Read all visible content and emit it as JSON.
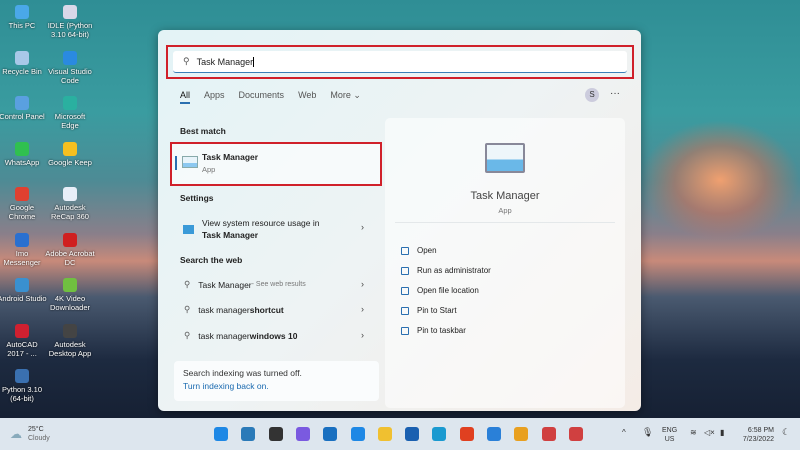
{
  "desktop_icons": [
    {
      "label": "This PC",
      "color": "#4aa8e8"
    },
    {
      "label": "IDLE (Python 3.10 64-bit)",
      "color": "#d8d8e8"
    },
    {
      "label": "Recycle Bin",
      "color": "#a8c8e8"
    },
    {
      "label": "Visual Studio Code",
      "color": "#2a8ae0"
    },
    {
      "label": "Control Panel",
      "color": "#5aa0e0"
    },
    {
      "label": "Microsoft Edge",
      "color": "#2ab0a0"
    },
    {
      "label": "WhatsApp",
      "color": "#30c050"
    },
    {
      "label": "Google Keep",
      "color": "#f5c020"
    },
    {
      "label": "Google Chrome",
      "color": "#e04030"
    },
    {
      "label": "Autodesk ReCap 360",
      "color": "#e8eef8"
    },
    {
      "label": "Imo Messenger",
      "color": "#2a70d0"
    },
    {
      "label": "Adobe Acrobat DC",
      "color": "#d02020"
    },
    {
      "label": "Android Studio",
      "color": "#3a90d0"
    },
    {
      "label": "4K Video Downloader",
      "color": "#70c040"
    },
    {
      "label": "AutoCAD 2017 - ...",
      "color": "#d02030"
    },
    {
      "label": "Autodesk Desktop App",
      "color": "#444"
    },
    {
      "label": "Python 3.10 (64-bit)",
      "color": "#3a70b0"
    }
  ],
  "search": {
    "value": "Task Manager"
  },
  "tabs": [
    "All",
    "Apps",
    "Documents",
    "Web",
    "More ⌄"
  ],
  "avatar": "S",
  "more_icon": "···",
  "best_match": {
    "heading": "Best match",
    "title": "Task Manager",
    "subtitle": "App"
  },
  "settings": {
    "heading": "Settings",
    "line1": "View system resource usage in",
    "line2": "Task Manager"
  },
  "web": {
    "heading": "Search the web",
    "items": [
      {
        "normal": "Task Manager",
        "bold": "",
        "suffix": " - See web results"
      },
      {
        "normal": "task manager ",
        "bold": "shortcut",
        "suffix": ""
      },
      {
        "normal": "task manager ",
        "bold": "windows 10",
        "suffix": ""
      }
    ]
  },
  "indexing": {
    "msg": "Search indexing was turned off.",
    "link": "Turn indexing back on."
  },
  "preview": {
    "title": "Task Manager",
    "subtitle": "App",
    "actions": [
      "Open",
      "Run as administrator",
      "Open file location",
      "Pin to Start",
      "Pin to taskbar"
    ]
  },
  "weather": {
    "temp": "25°C",
    "cond": "Cloudy"
  },
  "tray": {
    "lang1": "ENG",
    "lang2": "US",
    "time": "6:58 PM",
    "date": "7/23/2022"
  },
  "colors": {
    "accent": "#2a6fb0",
    "highlight": "#d0202a"
  }
}
